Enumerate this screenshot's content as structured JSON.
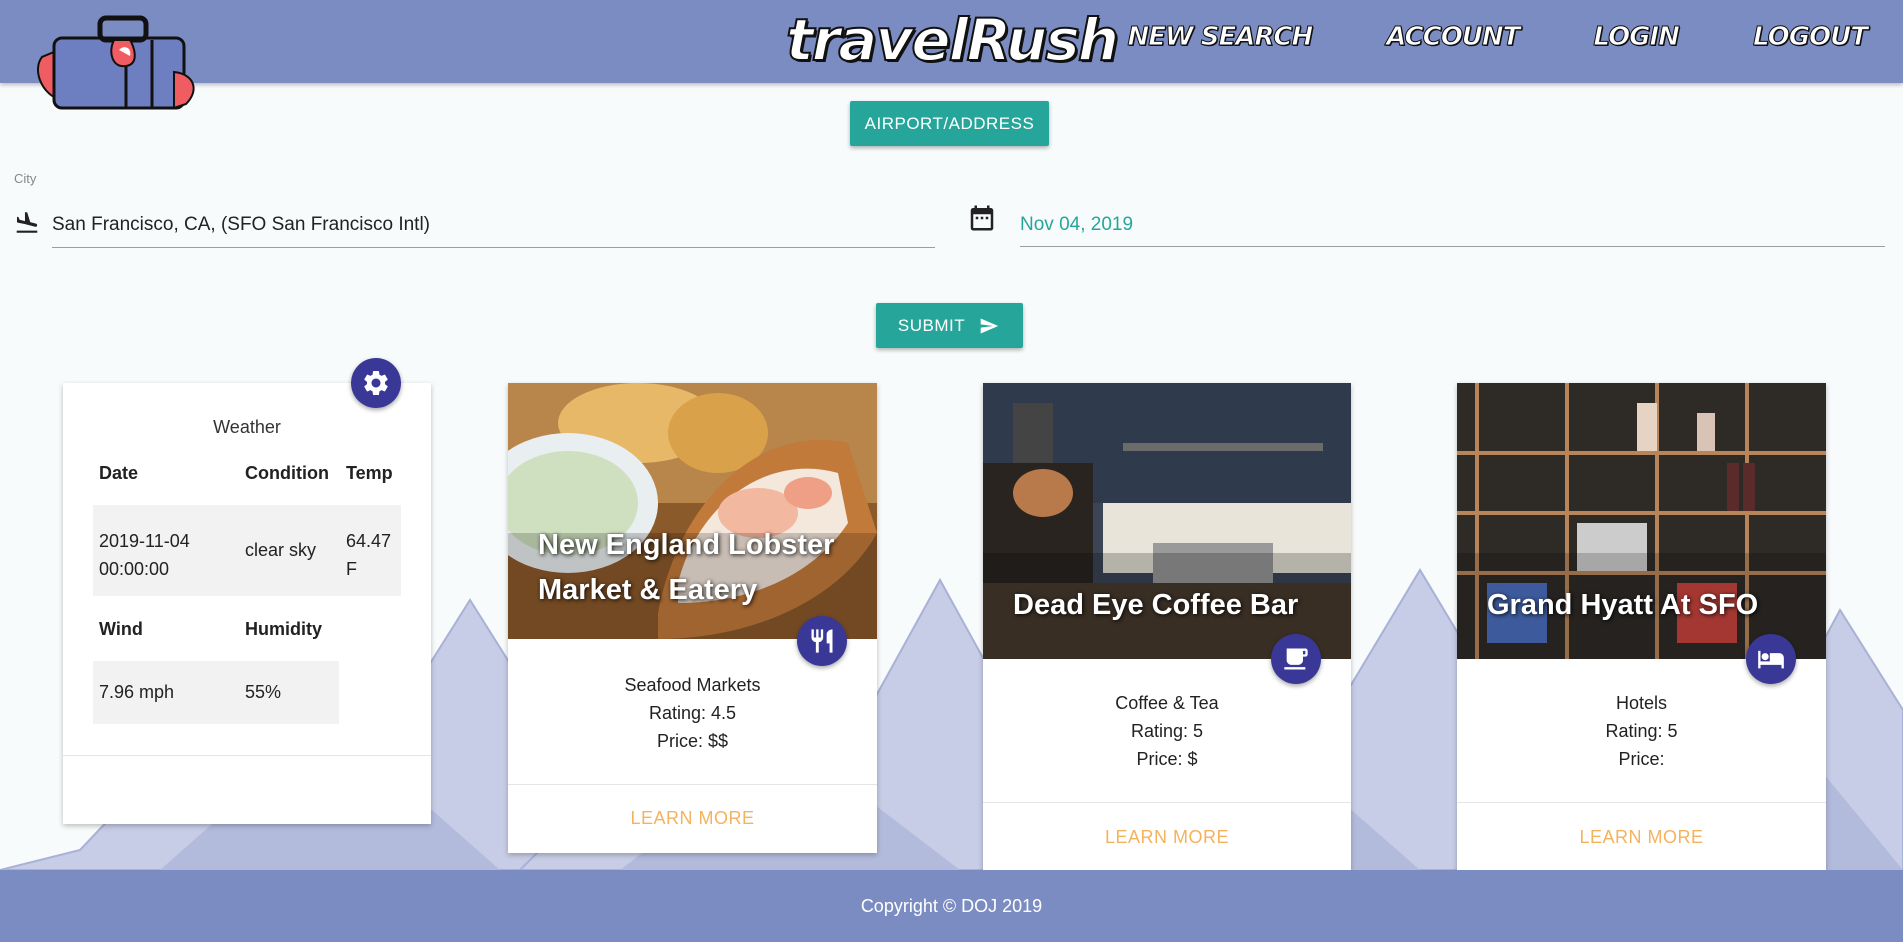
{
  "nav": {
    "brand": "travelRush",
    "links": [
      "NEW SEARCH",
      "ACCOUNT",
      "LOGIN",
      "LOGOUT"
    ]
  },
  "search": {
    "mode_button": "AIRPORT/ADDRESS",
    "city_label": "City",
    "city_value": "San Francisco, CA, (SFO San Francisco Intl)",
    "date_value": "Nov 04, 2019",
    "submit_label": "SUBMIT"
  },
  "weather": {
    "title": "Weather",
    "headers": [
      "Date",
      "Condition",
      "Temp"
    ],
    "date_line1": "2019-11-04",
    "date_line2": "00:00:00",
    "condition": "clear sky",
    "temp_line1": "64.47",
    "temp_line2": "F",
    "headers2": [
      "Wind",
      "Humidity"
    ],
    "wind": "7.96 mph",
    "humidity": "55%"
  },
  "places": [
    {
      "title_line1": "New England Lobster",
      "title_line2": "Market & Eatery",
      "category": "Seafood Markets",
      "rating": "Rating: 4.5",
      "price": "Price: $$",
      "action": "LEARN MORE",
      "icon": "restaurant-icon"
    },
    {
      "title_line1": "Dead Eye Coffee Bar",
      "category": "Coffee & Tea",
      "rating": "Rating: 5",
      "price": "Price: $",
      "action": "LEARN MORE",
      "icon": "coffee-icon"
    },
    {
      "title_line1": "Grand Hyatt At SFO",
      "category": "Hotels",
      "rating": "Rating: 5",
      "price": "Price:",
      "action": "LEARN MORE",
      "icon": "hotel-bed-icon"
    }
  ],
  "footer": {
    "copyright": "Copyright © DOJ 2019"
  },
  "colors": {
    "navbar": "#7b8cc2",
    "teal": "#26a69a",
    "fab": "#3a3896",
    "link": "#f5b25d"
  }
}
